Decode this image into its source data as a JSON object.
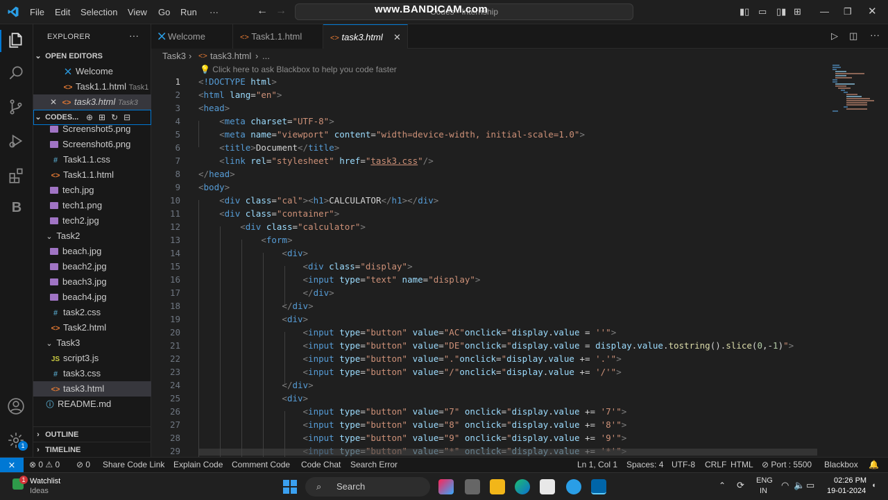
{
  "titlebar": {
    "menus": [
      "File",
      "Edit",
      "Selection",
      "View",
      "Go",
      "Run",
      "···"
    ],
    "command_center_text": "Codes - Internship",
    "watermark": "www.BANDICAM.com"
  },
  "sidebar": {
    "title": "EXPLORER",
    "more": "···",
    "open_editors_label": "OPEN EDITORS",
    "open_editors": [
      {
        "name": "Welcome",
        "desc": ""
      },
      {
        "name": "Task1.1.html",
        "desc": "Task1"
      },
      {
        "name": "task3.html",
        "desc": "Task3"
      }
    ],
    "folder_label": "CODES...",
    "files": [
      {
        "name": "Screenshot5.png",
        "type": "img"
      },
      {
        "name": "Screenshot6.png",
        "type": "img"
      },
      {
        "name": "Task1.1.css",
        "type": "css"
      },
      {
        "name": "Task1.1.html",
        "type": "html"
      },
      {
        "name": "tech.jpg",
        "type": "img"
      },
      {
        "name": "tech1.png",
        "type": "img"
      },
      {
        "name": "tech2.jpg",
        "type": "img"
      },
      {
        "name": "Task2",
        "type": "folder"
      },
      {
        "name": "beach.jpg",
        "type": "img"
      },
      {
        "name": "beach2.jpg",
        "type": "img"
      },
      {
        "name": "beach3.jpg",
        "type": "img"
      },
      {
        "name": "beach4.jpg",
        "type": "img"
      },
      {
        "name": "task2.css",
        "type": "css"
      },
      {
        "name": "Task2.html",
        "type": "html"
      },
      {
        "name": "Task3",
        "type": "folder"
      },
      {
        "name": "script3.js",
        "type": "js"
      },
      {
        "name": "task3.css",
        "type": "css"
      },
      {
        "name": "task3.html",
        "type": "html"
      },
      {
        "name": "README.md",
        "type": "info"
      }
    ],
    "outline_label": "OUTLINE",
    "timeline_label": "TIMELINE"
  },
  "tabs": [
    {
      "label": "Welcome"
    },
    {
      "label": "Task1.1.html"
    },
    {
      "label": "task3.html"
    }
  ],
  "breadcrumb": {
    "folder": "Task3",
    "file": "task3.html",
    "more": "..."
  },
  "editor": {
    "hint": "Click here to ask Blackbox to help you code faster",
    "line_numbers": [
      "1",
      "2",
      "3",
      "4",
      "5",
      "6",
      "7",
      "8",
      "9",
      "10",
      "11",
      "12",
      "13",
      "14",
      "15",
      "16",
      "17",
      "18",
      "19",
      "20",
      "21",
      "22",
      "23",
      "24",
      "25",
      "26",
      "27",
      "28",
      "29"
    ]
  },
  "status": {
    "problems": "0",
    "warnings": "0",
    "ports": "0",
    "items": [
      "Share Code Link",
      "Explain Code",
      "Comment Code",
      "Code Chat",
      "Search Error"
    ],
    "position": "Ln 1, Col 1",
    "spaces": "Spaces: 4",
    "encoding": "UTF-8",
    "eol": "CRLF",
    "language": "HTML",
    "port": "Port : 5500",
    "blackbox": "Blackbox"
  },
  "taskbar": {
    "widget_title": "Watchlist",
    "widget_sub": "Ideas",
    "widget_badge": "1",
    "search": "Search",
    "lang": "ENG",
    "region": "IN",
    "time": "02:26 PM",
    "date": "19-01-2024"
  },
  "accounts_badge": "1"
}
